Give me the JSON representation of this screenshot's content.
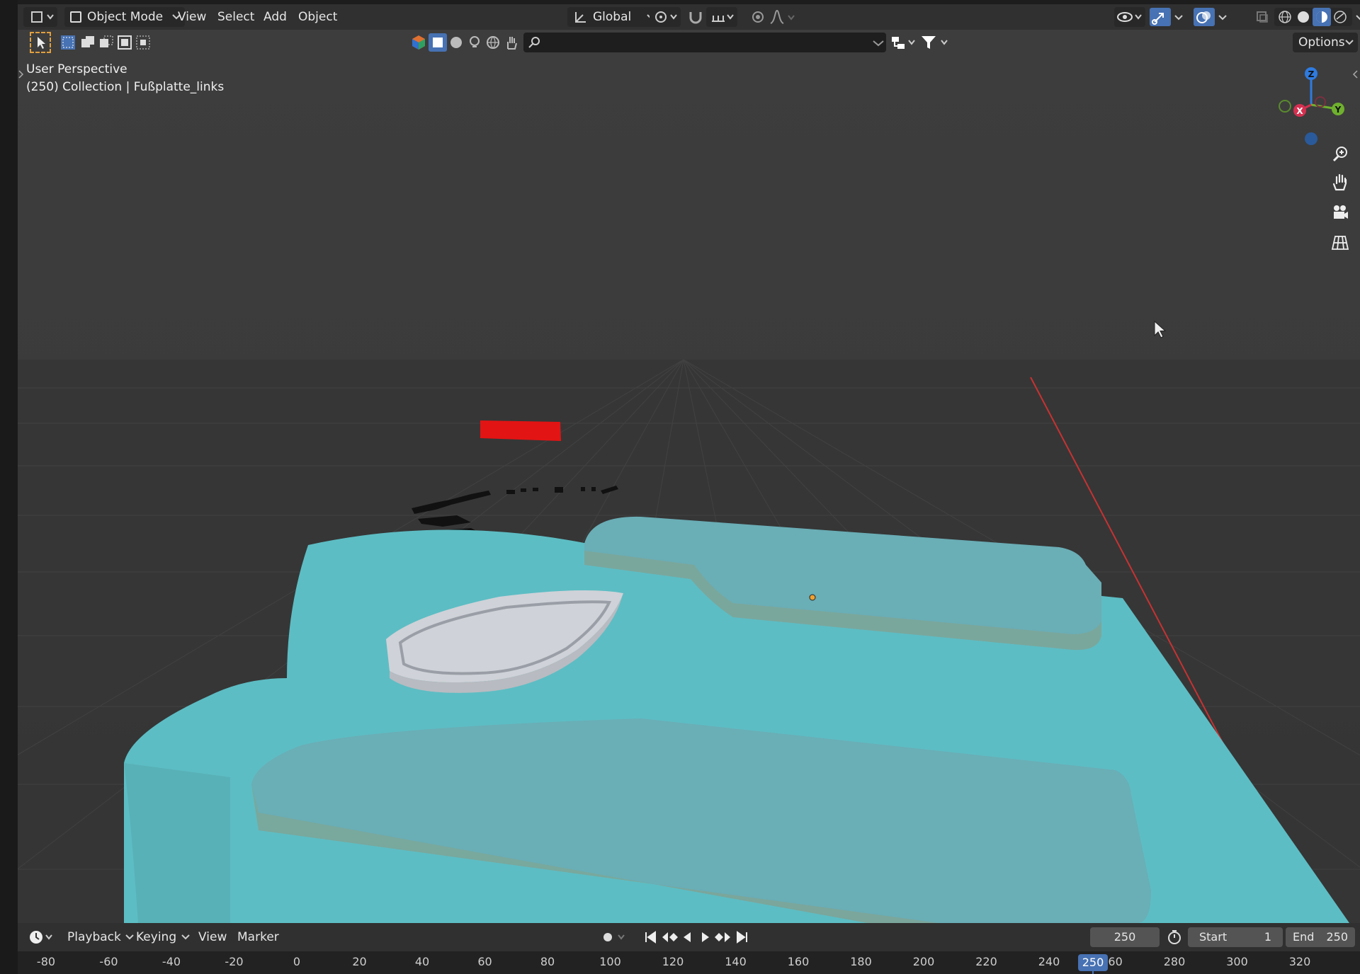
{
  "header": {
    "mode_label": "Object Mode",
    "menus": [
      "View",
      "Select",
      "Add",
      "Object"
    ],
    "transform_orientation": "Global",
    "options_label": "Options",
    "search_placeholder": ""
  },
  "viewport": {
    "perspective_label": "User Perspective",
    "collection_label": "(250) Collection | Fußplatte_links",
    "gizmo_axes": {
      "z": "Z",
      "y": "Y",
      "x": "X"
    },
    "colors": {
      "base_plate": "#5dbdc4",
      "raised_pad": "#6aaeb6",
      "heel_cup": "#cfd2d8",
      "red_block": "#e31414",
      "x_axis_line": "#c83232"
    }
  },
  "timeline": {
    "menus": [
      "Playback",
      "Keying",
      "View",
      "Marker"
    ],
    "current_frame": "250",
    "start_label": "Start",
    "start_value": "1",
    "end_label": "End",
    "end_value": "250",
    "ruler_ticks": [
      "-80",
      "-60",
      "-40",
      "-20",
      "0",
      "20",
      "40",
      "60",
      "80",
      "100",
      "120",
      "140",
      "160",
      "180",
      "200",
      "220",
      "240",
      "260",
      "280",
      "300",
      "320"
    ],
    "playhead_label": "250"
  }
}
